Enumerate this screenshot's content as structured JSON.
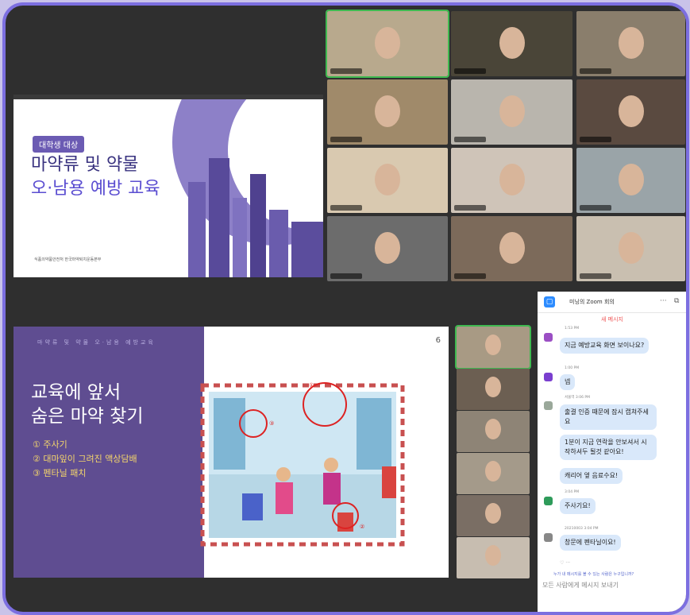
{
  "window": {
    "border_color": "#7c6fe0",
    "background": "#2f2f2f"
  },
  "slide_top": {
    "badge": "대학생 대상",
    "title_line1": "마약류 및 약물",
    "title_line2": "오·남용 예방 교육",
    "logos_text": "식품의약품안전처   한국마약퇴치운동본부"
  },
  "video_grid": {
    "tiles": [
      {
        "active": true,
        "tone": "#b8a98d"
      },
      {
        "active": false,
        "tone": "#4a4538"
      },
      {
        "active": false,
        "tone": "#8a7e6c"
      },
      {
        "active": false,
        "tone": "#a08a6a"
      },
      {
        "active": false,
        "tone": "#b9b5ad"
      },
      {
        "active": false,
        "tone": "#5a4a40"
      },
      {
        "active": false,
        "tone": "#d9c9b0"
      },
      {
        "active": false,
        "tone": "#cfc4b8"
      },
      {
        "active": false,
        "tone": "#9aa4a8"
      },
      {
        "active": false,
        "tone": "#6c6c6c"
      },
      {
        "active": false,
        "tone": "#7c6a5a"
      },
      {
        "active": false,
        "tone": "#c9bfb0"
      }
    ]
  },
  "slide_bottom": {
    "header": "마약류 및 약물 오·남용 예방교육",
    "page_number": "6",
    "title_line1": "교육에 앞서",
    "title_line2": "숨은 마약 찾기",
    "bullets": [
      "① 주사기",
      "② 대마잎이 그려진 액상담배",
      "③ 펜타닐 패치"
    ],
    "markers": [
      "①",
      "②",
      "③"
    ]
  },
  "chat": {
    "title": "미닝의 Zoom 회의",
    "new_message_label": "새 메시지",
    "messages": [
      {
        "meta": "1:53 PM",
        "text": "지금 예방교육 화면 보이나요?",
        "avatar": "#9b4fc4"
      },
      {
        "meta": "1:00 PM",
        "text": "넵",
        "avatar": "#7a3fcf"
      },
      {
        "meta": "서울역 3:06 PM",
        "text": "출결 인증 때문에 잠시 캡쳐주세요",
        "avatar": "#9aa89a"
      },
      {
        "meta": "",
        "text": "1분이 지금 연락을 안보셔서 시작하셔두 될것 같아요!",
        "avatar": ""
      },
      {
        "meta": "",
        "text": "캐리어 옆 음료수요!",
        "avatar": ""
      },
      {
        "meta": "3:04 PM",
        "text": "주사기요!",
        "avatar": "#2e9b5a"
      },
      {
        "meta": "20210003 3:04 PM",
        "text": "창문에 펜타닐이요!",
        "avatar": "#888888"
      }
    ],
    "reaction": "♡ ···",
    "warning": "누가 내 메시지를 볼 수 있는 사람은 누구입니까?",
    "input_placeholder": "모든 사람에게 메시지 보내기"
  }
}
